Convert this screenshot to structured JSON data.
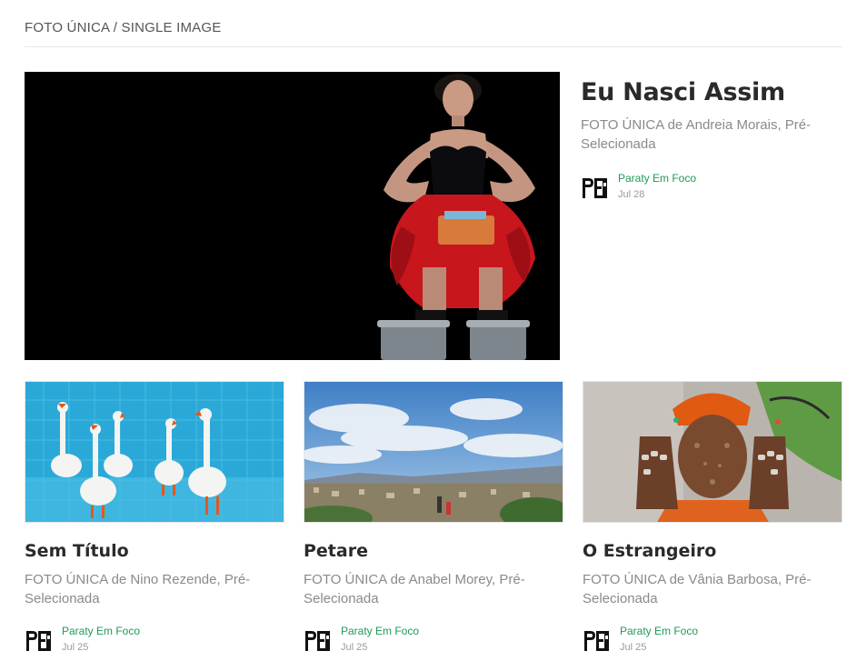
{
  "section": {
    "title": "FOTO ÚNICA / SINGLE IMAGE"
  },
  "featured": {
    "title": "Eu Nasci Assim",
    "subtitle": "FOTO ÚNICA de Andreia Morais, Pré-Selecionada",
    "author": "Paraty Em Foco",
    "date": "Jul 28",
    "image_icon": "photo-woman-red-tutu"
  },
  "posts": [
    {
      "title": "Sem Título",
      "subtitle": "FOTO ÚNICA de Nino Rezende, Pré-Selecionada",
      "author": "Paraty Em Foco",
      "date": "Jul 25",
      "image_icon": "photo-geese-pool"
    },
    {
      "title": "Petare",
      "subtitle": "FOTO ÚNICA de Anabel Morey, Pré-Selecionada",
      "author": "Paraty Em Foco",
      "date": "Jul 25",
      "image_icon": "photo-city-sky"
    },
    {
      "title": "O Estrangeiro",
      "subtitle": "FOTO ÚNICA de Vânia Barbosa, Pré-Selecionada",
      "author": "Paraty Em Foco",
      "date": "Jul 25",
      "image_icon": "photo-man-rings"
    }
  ],
  "colors": {
    "accent": "#1f9a57",
    "title": "#2a2a2a",
    "muted": "#8a8a8a"
  }
}
